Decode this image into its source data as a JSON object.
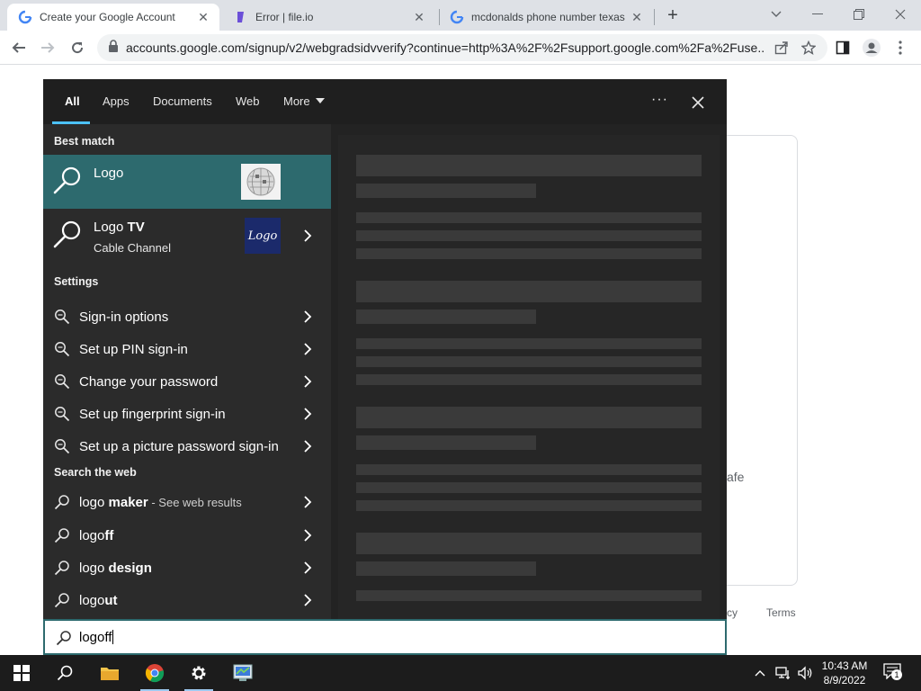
{
  "browser": {
    "tabs": [
      {
        "title": "Create your Google Account",
        "favicon": "google-g-icon",
        "active": true
      },
      {
        "title": "Error | file.io",
        "favicon": "fileio-icon",
        "active": false
      },
      {
        "title": "mcdonalds phone number texas",
        "favicon": "google-g-icon",
        "active": false
      }
    ],
    "new_tab_label": "+",
    "url": "accounts.google.com/signup/v2/webgradsidvverify?continue=http%3A%2F%2Fsupport.google.com%2Fa%2Fuse..."
  },
  "page": {
    "safe_text": "afe",
    "footer_privacy": "cy",
    "footer_terms": "Terms"
  },
  "search": {
    "tabs": [
      "All",
      "Apps",
      "Documents",
      "Web",
      "More"
    ],
    "active_tab": "All",
    "more_icon": "ellipsis-icon",
    "best_match_heading": "Best match",
    "best_match": {
      "title": "Logo",
      "thumb": "wikipedia-globe-icon"
    },
    "logo_tv": {
      "title_plain": "Logo ",
      "title_bold": "TV",
      "subtitle": "Cable Channel",
      "thumb_text": "Logo"
    },
    "settings_heading": "Settings",
    "settings": [
      "Sign-in options",
      "Set up PIN sign-in",
      "Change your password",
      "Set up fingerprint sign-in",
      "Set up a picture password sign-in"
    ],
    "web_heading": "Search the web",
    "web": [
      {
        "plain": "logo ",
        "bold": "maker",
        "suffix": " - See web results"
      },
      {
        "plain": "logo",
        "bold": "ff",
        "suffix": ""
      },
      {
        "plain": "logo ",
        "bold": "design",
        "suffix": ""
      },
      {
        "plain": "logo",
        "bold": "ut",
        "suffix": ""
      }
    ],
    "query": "logoff"
  },
  "taskbar": {
    "time": "10:43 AM",
    "date": "8/9/2022",
    "notification_count": "1"
  },
  "colors": {
    "accent_teal": "#2d6a6e",
    "tab_underline": "#4cc2ff",
    "panel_bg": "#1f1f1f"
  }
}
